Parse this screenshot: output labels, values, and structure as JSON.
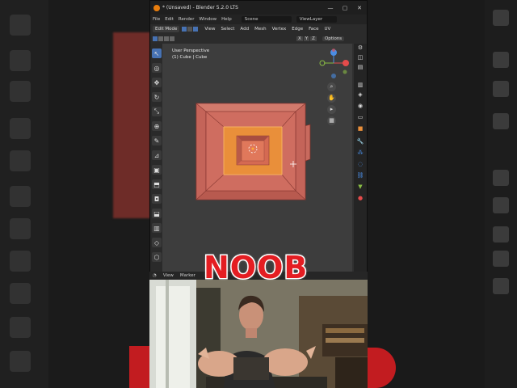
{
  "window": {
    "title": "* (Unsaved) - Blender 5.2.0 LTS",
    "controls": [
      "—",
      "▢",
      "✕"
    ]
  },
  "menubar": {
    "items": [
      "File",
      "Edit",
      "Render",
      "Window",
      "Help"
    ],
    "scene": "Scene",
    "view_layer": "ViewLayer"
  },
  "header": {
    "mode": "Edit Mode",
    "menus": [
      "View",
      "Select",
      "Add",
      "Mesh",
      "Vertex",
      "Edge",
      "Face",
      "UV"
    ],
    "axes": [
      "X",
      "Y",
      "Z"
    ],
    "options": "Options"
  },
  "viewport": {
    "perspective": "User Perspective",
    "object": "(1) Cube | Cube"
  },
  "timeline": {
    "items": [
      "View",
      "Marker"
    ]
  },
  "overlay": {
    "caption": "NOOB"
  },
  "colors": {
    "accent": "#4772b3",
    "cube": "#c8675b",
    "selected_face": "#e88c33",
    "caption": "#e41d22"
  }
}
